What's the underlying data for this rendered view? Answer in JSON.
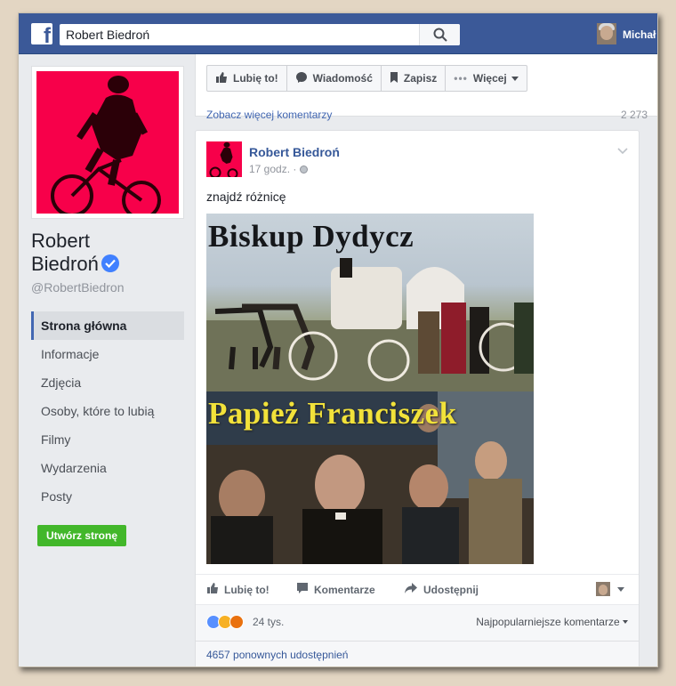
{
  "topbar": {
    "logo_letter": "f",
    "search_value": "Robert Biedroń",
    "user_name": "Michał"
  },
  "actions": {
    "like": "Lubię to!",
    "message": "Wiadomość",
    "save": "Zapisz",
    "more": "Więcej"
  },
  "previous_post": {
    "more_comments": "Zobacz więcej komentarzy",
    "count": "2 273"
  },
  "page": {
    "name_line1": "Robert",
    "name_line2": "Biedroń",
    "handle": "@RobertBiedron"
  },
  "nav": {
    "items": [
      "Strona główna",
      "Informacje",
      "Zdjęcia",
      "Osoby, które to lubią",
      "Filmy",
      "Wydarzenia",
      "Posty"
    ],
    "active": "Strona główna"
  },
  "create_page_button": "Utwórz stronę",
  "post": {
    "author": "Robert Biedroń",
    "time": "17 godz.",
    "separator": "·",
    "text": "znajdź różnicę",
    "image": {
      "caption_top": "Biskup Dydycz",
      "caption_bottom": "Papież Franciszek"
    },
    "buttons": {
      "like": "Lubię to!",
      "comment": "Komentarze",
      "share": "Udostępnij"
    },
    "reactions_count": "24 tys.",
    "top_comments": "Najpopularniejsze komentarze",
    "shares": "4657 ponownych udostępnień"
  },
  "colors": {
    "brand": "#3b5998",
    "profile_bg": "#f7004a",
    "create_button": "#42b72a",
    "link": "#365899"
  }
}
